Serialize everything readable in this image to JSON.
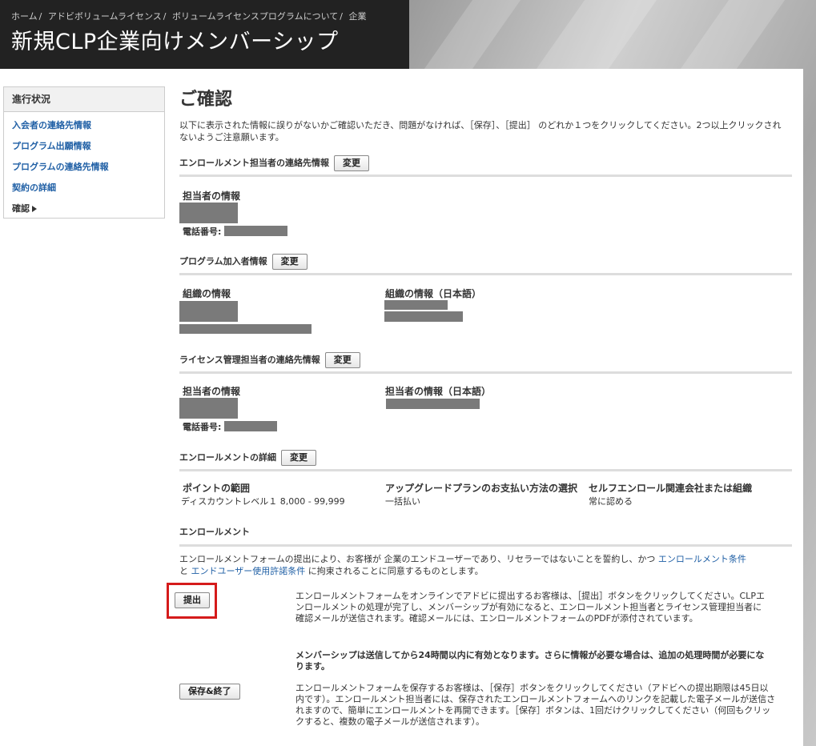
{
  "breadcrumb": [
    "ホーム",
    "アドビボリュームライセンス",
    "ボリュームライセンスプログラムについて",
    "企業"
  ],
  "page_title": "新規CLP企業向けメンバーシップ",
  "sidebar": {
    "title": "進行状況",
    "items": [
      {
        "label": "入会者の連絡先情報"
      },
      {
        "label": "プログラム出願情報"
      },
      {
        "label": "プログラムの連絡先情報"
      },
      {
        "label": "契約の詳細"
      },
      {
        "label": "確認"
      }
    ]
  },
  "main": {
    "heading": "ご確認",
    "intro": "以下に表示された情報に誤りがないかご確認いただき、問題がなければ、［保存］、［提出］ のどれか１つをクリックしてください。2つ以上クリックされないようご注意願います。",
    "change_label": "変更",
    "sections": {
      "enroll_contact": {
        "title": "エンロールメント担当者の連絡先情報",
        "contact_label": "担当者の情報",
        "phone_label": "電話番号:"
      },
      "program_enrollee": {
        "title": "プログラム加入者情報",
        "org_label": "組織の情報",
        "org_label_ja": "組織の情報（日本語）"
      },
      "license_admin": {
        "title": "ライセンス管理担当者の連絡先情報",
        "contact_label": "担当者の情報",
        "contact_label_ja": "担当者の情報（日本語）",
        "phone_label": "電話番号:"
      },
      "enrollment_details": {
        "title": "エンロールメントの詳細",
        "points_label": "ポイントの範囲",
        "points_value": "ディスカウントレベル１  8,000 -  99,999",
        "upgrade_label": "アップグレードプランのお支払い方法の選択",
        "upgrade_value": "一括払い",
        "self_label": "セルフエンロール関連会社または組織",
        "self_value": "常に認める"
      },
      "enrollment": {
        "title": "エンロールメント",
        "agree_before": "エンロールメントフォームの提出により、お客様が 企業のエンドユーザーであり、リセラーではないことを誓約し、かつ ",
        "link_terms": "エンロールメント条件",
        "agree_and": "と ",
        "link_eula": "エンドユーザー使用許諾条件",
        "agree_after": " に拘束されることに同意するものとします。"
      }
    },
    "submit_button": "提出",
    "submit_desc": "エンロールメントフォームをオンラインでアドビに提出するお客様は、［提出］ボタンをクリックしてください。CLPエンロールメントの処理が完了し、メンバーシップが有効になると、エンロールメント担当者とライセンス管理担当者に確認メールが送信されます。確認メールには、エンロールメントフォームのPDFが添付されています。",
    "submit_note": "メンバーシップは送信してから24時間以内に有効となります。さらに情報が必要な場合は、追加の処理時間が必要になります。",
    "save_button": "保存&終了",
    "save_desc": "エンロールメントフォームを保存するお客様は、［保存］ボタンをクリックしてください（アドビへの提出期限は45日以内です）。エンロールメント担当者には、保存されたエンロールメントフォームへのリンクを記載した電子メールが送信されますので、簡単にエンロールメントを再開できます。［保存］ボタンは、1回だけクリックしてください（何回もクリックすると、複数の電子メールが送信されます）。"
  },
  "colors": {
    "link": "#1f5fa5",
    "highlight": "#d51b1b",
    "header_bg": "#222222"
  }
}
